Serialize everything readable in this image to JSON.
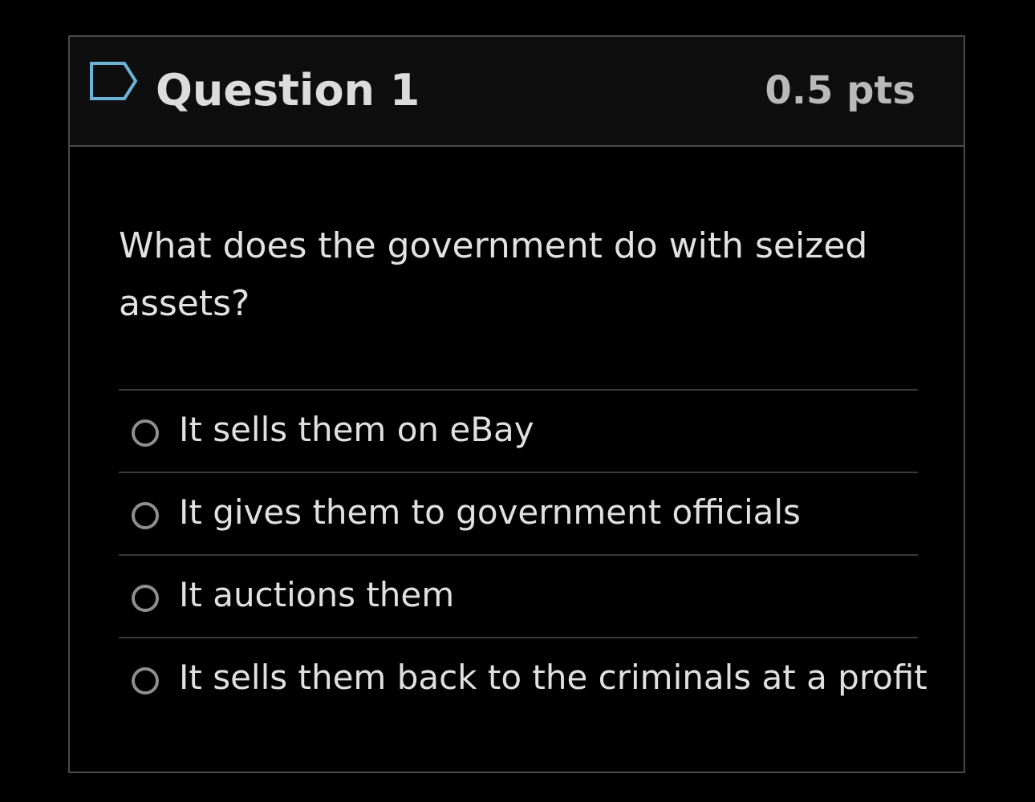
{
  "question": {
    "title": "Question 1",
    "points": "0.5 pts",
    "text": "What does the government do with seized assets?",
    "flag_icon": "flag-outline-icon",
    "accent_color": "#6bb3d6"
  },
  "answers": [
    {
      "label": "It sells them on eBay",
      "selected": false
    },
    {
      "label": "It gives them to government officials",
      "selected": false
    },
    {
      "label": "It auctions them",
      "selected": false
    },
    {
      "label": "It sells them back to the criminals at a profit",
      "selected": false
    }
  ]
}
